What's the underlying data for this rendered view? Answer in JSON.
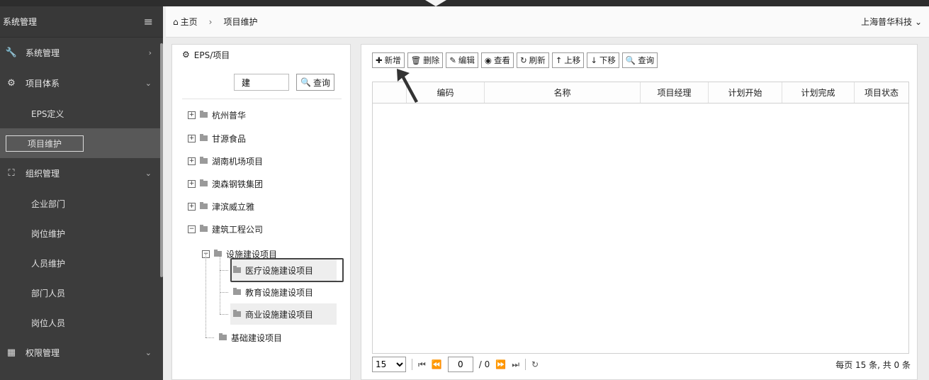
{
  "sidebar": {
    "title": "系统管理",
    "menu_icon": "hamburger-icon",
    "items": [
      {
        "label": "系统管理",
        "icon": "wrench-icon",
        "arrow": "›"
      },
      {
        "label": "项目体系",
        "icon": "gears-icon",
        "arrow": "⌄"
      },
      {
        "label": "EPS定义"
      },
      {
        "label": "项目维护"
      },
      {
        "label": "组织管理",
        "icon": "sitemap-icon",
        "arrow": "⌄"
      },
      {
        "label": "企业部门"
      },
      {
        "label": "岗位维护"
      },
      {
        "label": "人员维护"
      },
      {
        "label": "部门人员"
      },
      {
        "label": "岗位人员"
      },
      {
        "label": "权限管理",
        "icon": "grid-icon",
        "arrow": "⌄"
      }
    ]
  },
  "topbar": {
    "home_label": "主页",
    "separator": "›",
    "crumb": "项目维护",
    "company": "上海普华科技"
  },
  "tree_panel": {
    "title": "EPS/项目",
    "search_value": "建",
    "search_button": "查询",
    "nodes": [
      {
        "label": "杭州普华",
        "toggle": "+"
      },
      {
        "label": "甘源食品",
        "toggle": "+"
      },
      {
        "label": "湖南机场项目",
        "toggle": "+"
      },
      {
        "label": "澳森钢铁集团",
        "toggle": "+"
      },
      {
        "label": "津滨威立雅",
        "toggle": "+"
      },
      {
        "label": "建筑工程公司",
        "toggle": "−"
      },
      {
        "label": "设施建设项目",
        "toggle": "−"
      },
      {
        "label": "医疗设施建设项目"
      },
      {
        "label": "教育设施建设项目"
      },
      {
        "label": "商业设施建设项目"
      },
      {
        "label": "基础建设项目"
      }
    ]
  },
  "toolbar": {
    "add": "新增",
    "delete": "删除",
    "edit": "编辑",
    "view": "查看",
    "refresh": "刷新",
    "move_up": "上移",
    "move_down": "下移",
    "query": "查询"
  },
  "grid": {
    "columns": [
      "编码",
      "名称",
      "项目经理",
      "计划开始",
      "计划完成",
      "项目状态"
    ],
    "rows": []
  },
  "pager": {
    "page_size": "15",
    "current_page": "0",
    "total_pages": "/ 0",
    "info": "每页 15 条, 共 0 条"
  }
}
